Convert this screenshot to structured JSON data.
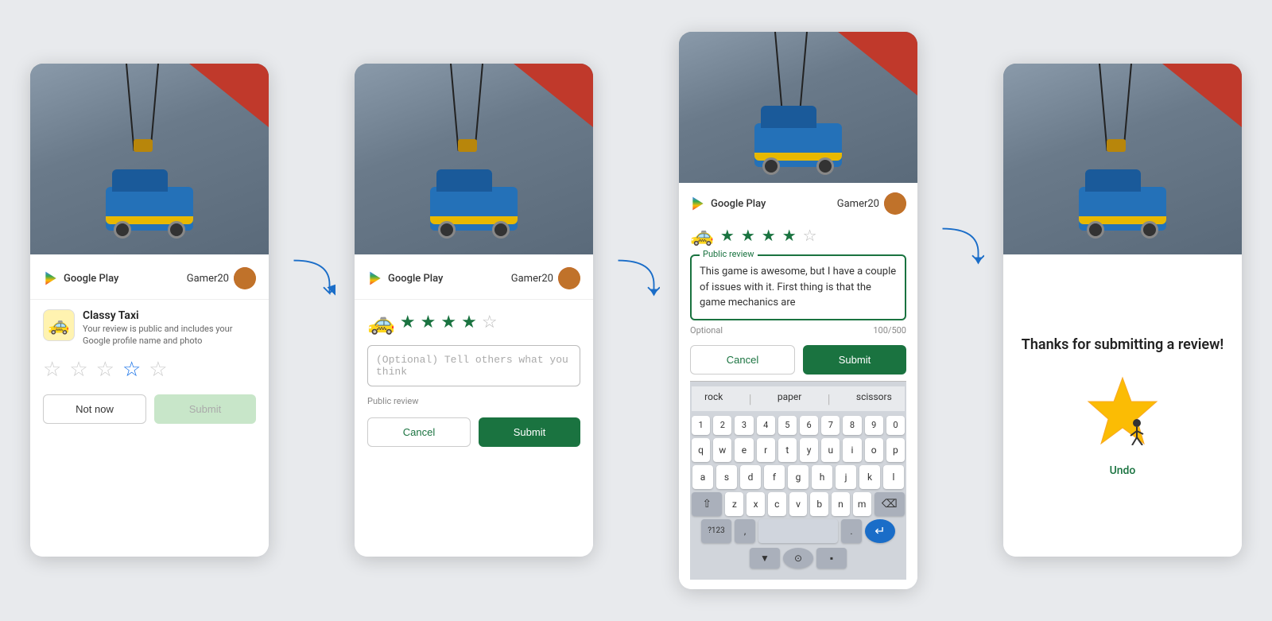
{
  "screens": [
    {
      "id": "screen1",
      "header": {
        "gplay_label": "Google Play",
        "user_name": "Gamer20"
      },
      "app": {
        "icon": "🚕",
        "name": "Classy Taxi",
        "description": "Your review is public and includes your Google profile name and photo"
      },
      "stars": [
        "empty",
        "empty",
        "empty",
        "empty",
        "empty"
      ],
      "buttons": {
        "not_now": "Not now",
        "submit": "Submit"
      }
    },
    {
      "id": "screen2",
      "header": {
        "gplay_label": "Google Play",
        "user_name": "Gamer20"
      },
      "stars": [
        "filled",
        "filled",
        "filled",
        "filled",
        "empty"
      ],
      "review_placeholder": "(Optional) Tell others what you think",
      "public_review_label": "Public review",
      "buttons": {
        "cancel": "Cancel",
        "submit": "Submit"
      }
    },
    {
      "id": "screen3",
      "header": {
        "gplay_label": "Google Play",
        "user_name": "Gamer20"
      },
      "stars": [
        "filled",
        "filled",
        "filled",
        "filled",
        "empty"
      ],
      "review_label": "Public review",
      "review_text": "This game is awesome, but I have a couple of issues with it. First thing is that the game mechanics are",
      "optional_label": "Optional",
      "char_count": "100/500",
      "buttons": {
        "cancel": "Cancel",
        "submit": "Submit"
      },
      "keyboard": {
        "suggestions": [
          "rock",
          "paper",
          "scissors"
        ],
        "rows": [
          [
            "q",
            "w",
            "e",
            "r",
            "t",
            "y",
            "u",
            "i",
            "o",
            "p"
          ],
          [
            "a",
            "s",
            "d",
            "f",
            "g",
            "h",
            "j",
            "k",
            "l"
          ],
          [
            "z",
            "x",
            "c",
            "v",
            "b",
            "n",
            "m"
          ]
        ],
        "nums": [
          "1",
          "2",
          "3",
          "4",
          "5",
          "6",
          "7",
          "8",
          "9",
          "0"
        ]
      }
    },
    {
      "id": "screen4",
      "thanks_title": "Thanks for submitting a review!",
      "undo_label": "Undo"
    }
  ],
  "arrows": [
    {
      "id": "arrow1"
    },
    {
      "id": "arrow2"
    },
    {
      "id": "arrow3"
    }
  ]
}
